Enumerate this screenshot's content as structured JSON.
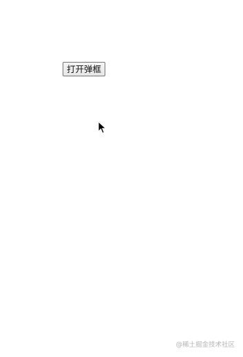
{
  "main": {
    "open_dialog_button_label": "打开弹框"
  },
  "cursor": {
    "icon": "arrow-pointer-icon"
  },
  "watermark": {
    "text": "@稀土掘金技术社区"
  }
}
